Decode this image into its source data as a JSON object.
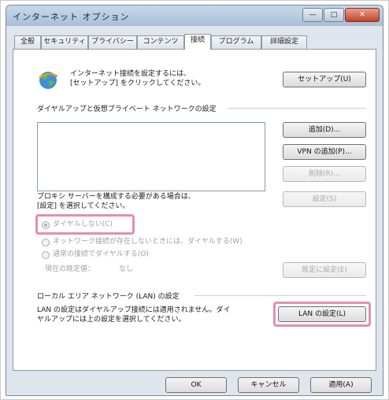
{
  "window": {
    "title": "インターネット オプション",
    "minimize_label": "—",
    "maximize_label": "□",
    "close_label": "✕"
  },
  "tabs": [
    {
      "label": "全般"
    },
    {
      "label": "セキュリティ"
    },
    {
      "label": "プライバシー"
    },
    {
      "label": "コンテンツ"
    },
    {
      "label": "接続"
    },
    {
      "label": "プログラム"
    },
    {
      "label": "詳細設定"
    }
  ],
  "setup": {
    "text_line1": "インターネット接続を設定するには、",
    "text_line2": "[セットアップ] をクリックしてください。",
    "button": "セットアップ(U)"
  },
  "dialup": {
    "section_title": "ダイヤルアップと仮想プライベート ネットワークの設定",
    "add_button": "追加(D)...",
    "add_vpn_button": "VPN の追加(P)...",
    "remove_button": "削除(R)...",
    "settings_button": "設定(S)",
    "proxy_text_line1": "プロキシ サーバーを構成する必要がある場合は、",
    "proxy_text_line2": "[設定] を選択してください。",
    "option_never": "ダイヤルしない(C)",
    "option_no_network": "ネットワーク接続が存在しないときには、ダイヤルする(W)",
    "option_always": "通常の接続でダイヤルする(O)",
    "current_label": "現在の既定値：",
    "current_value": "なし",
    "set_default_button": "既定に設定(E)"
  },
  "lan": {
    "section_title": "ローカル エリア ネットワーク (LAN) の設定",
    "text_line1": "LAN の設定はダイヤルアップ接続には適用されません。ダイ",
    "text_line2": "ヤルアップには上の設定を選択してください。",
    "button": "LAN の設定(L)"
  },
  "footer": {
    "ok": "OK",
    "cancel": "キャンセル",
    "apply": "適用(A)"
  },
  "colors": {
    "highlight": "#e58db4",
    "titlebar": "#b9cce0"
  }
}
